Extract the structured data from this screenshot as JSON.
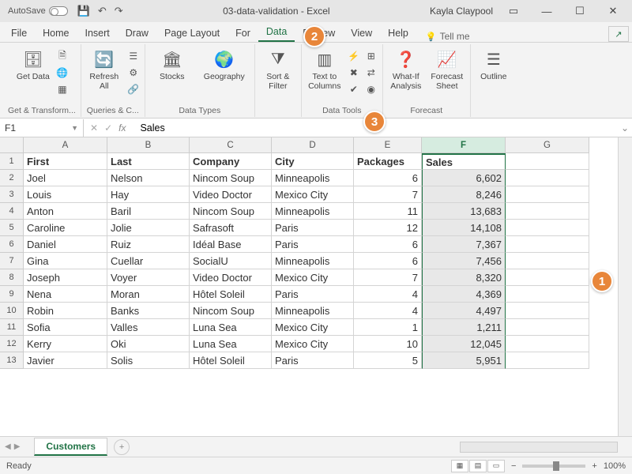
{
  "titlebar": {
    "autosave_label": "AutoSave",
    "title": "03-data-validation - Excel",
    "user": "Kayla Claypool"
  },
  "tabs": {
    "file": "File",
    "home": "Home",
    "insert": "Insert",
    "draw": "Draw",
    "page_layout": "Page Layout",
    "formulas": "For",
    "data": "Data",
    "review": "Review",
    "view": "View",
    "help": "Help",
    "tellme": "Tell me"
  },
  "ribbon": {
    "get_data": "Get\nData",
    "refresh_all": "Refresh\nAll",
    "group1_label": "Get & Transform...",
    "group2_label": "Queries & C...",
    "stocks": "Stocks",
    "geography": "Geography",
    "data_types_label": "Data Types",
    "sort_filter": "Sort &\nFilter",
    "text_to_columns": "Text to\nColumns",
    "data_tools_label": "Data Tools",
    "whatif": "What-If\nAnalysis",
    "forecast_sheet": "Forecast\nSheet",
    "forecast_label": "Forecast",
    "outline": "Outline"
  },
  "formula_bar": {
    "name_box": "F1",
    "fx": "fx",
    "value": "Sales"
  },
  "columns": [
    "A",
    "B",
    "C",
    "D",
    "E",
    "F",
    "G"
  ],
  "headers": {
    "first": "First",
    "last": "Last",
    "company": "Company",
    "city": "City",
    "packages": "Packages",
    "sales": "Sales"
  },
  "rows": [
    {
      "n": "1",
      "first": "First",
      "last": "Last",
      "company": "Company",
      "city": "City",
      "packages": "Packages",
      "sales": "Sales",
      "hdr": true
    },
    {
      "n": "2",
      "first": "Joel",
      "last": "Nelson",
      "company": "Nincom Soup",
      "city": "Minneapolis",
      "packages": "6",
      "sales": "6,602"
    },
    {
      "n": "3",
      "first": "Louis",
      "last": "Hay",
      "company": "Video Doctor",
      "city": "Mexico City",
      "packages": "7",
      "sales": "8,246"
    },
    {
      "n": "4",
      "first": "Anton",
      "last": "Baril",
      "company": "Nincom Soup",
      "city": "Minneapolis",
      "packages": "11",
      "sales": "13,683"
    },
    {
      "n": "5",
      "first": "Caroline",
      "last": "Jolie",
      "company": "Safrasoft",
      "city": "Paris",
      "packages": "12",
      "sales": "14,108"
    },
    {
      "n": "6",
      "first": "Daniel",
      "last": "Ruiz",
      "company": "Idéal Base",
      "city": "Paris",
      "packages": "6",
      "sales": "7,367"
    },
    {
      "n": "7",
      "first": "Gina",
      "last": "Cuellar",
      "company": "SocialU",
      "city": "Minneapolis",
      "packages": "6",
      "sales": "7,456"
    },
    {
      "n": "8",
      "first": "Joseph",
      "last": "Voyer",
      "company": "Video Doctor",
      "city": "Mexico City",
      "packages": "7",
      "sales": "8,320"
    },
    {
      "n": "9",
      "first": "Nena",
      "last": "Moran",
      "company": "Hôtel Soleil",
      "city": "Paris",
      "packages": "4",
      "sales": "4,369"
    },
    {
      "n": "10",
      "first": "Robin",
      "last": "Banks",
      "company": "Nincom Soup",
      "city": "Minneapolis",
      "packages": "4",
      "sales": "4,497"
    },
    {
      "n": "11",
      "first": "Sofia",
      "last": "Valles",
      "company": "Luna Sea",
      "city": "Mexico City",
      "packages": "1",
      "sales": "1,211"
    },
    {
      "n": "12",
      "first": "Kerry",
      "last": "Oki",
      "company": "Luna Sea",
      "city": "Mexico City",
      "packages": "10",
      "sales": "12,045"
    },
    {
      "n": "13",
      "first": "Javier",
      "last": "Solis",
      "company": "Hôtel Soleil",
      "city": "Paris",
      "packages": "5",
      "sales": "5,951"
    }
  ],
  "sheet": {
    "name": "Customers"
  },
  "status": {
    "ready": "Ready",
    "zoom": "100%"
  },
  "callouts": {
    "c1": "1",
    "c2": "2",
    "c3": "3"
  }
}
